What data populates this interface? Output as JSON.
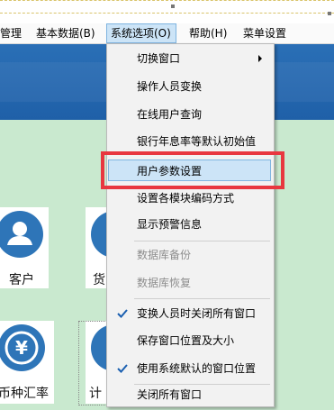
{
  "menubar": {
    "items": [
      {
        "label": "管理"
      },
      {
        "label": "基本数据(B)"
      },
      {
        "label": "系统选项(O)"
      },
      {
        "label": "帮助(H)"
      },
      {
        "label": "菜单设置"
      }
    ]
  },
  "tiles": [
    {
      "label": "客户",
      "icon": "customer-icon"
    },
    {
      "label": "货",
      "icon": "goods-icon"
    },
    {
      "label": "币种汇率",
      "icon": "currency-icon"
    },
    {
      "label": "计",
      "icon": "calculate-icon"
    }
  ],
  "dropdown": {
    "items": [
      {
        "label": "切换窗口",
        "submenu": true
      },
      {
        "label": "操作人员变换"
      },
      {
        "label": "在线用户查询"
      },
      {
        "label": "银行年息率等默认初始值"
      },
      {
        "label": "用户参数设置",
        "highlighted": true
      },
      {
        "label": "设置各模块编码方式"
      },
      {
        "label": "显示预警信息"
      },
      {
        "label": "数据库备份",
        "disabled": true
      },
      {
        "label": "数据库恢复",
        "disabled": true
      },
      {
        "label": "变换人员时关闭所有窗口",
        "checked": true
      },
      {
        "label": "保存窗口位置及大小"
      },
      {
        "label": "使用系统默认的窗口位置",
        "checked": true
      },
      {
        "label": "关闭所有窗口"
      }
    ]
  },
  "colors": {
    "accent": "#2e75b8",
    "highlight_border": "#e8373f",
    "background": "#c9e9cf"
  }
}
